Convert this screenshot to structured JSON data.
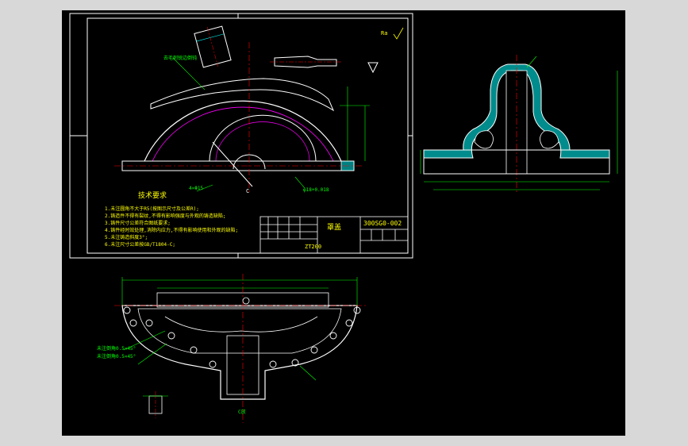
{
  "drawing": {
    "part_name": "罩盖",
    "drawing_number": "300SG0-002",
    "material": "ZT200",
    "surface_mark": "Ra",
    "section_label": "C",
    "detail_label": "C放"
  },
  "technical_requirements": {
    "heading": "技术要求",
    "items": [
      "1.未注圆角不大于R5(按图示尺寸及公差R);",
      "2.铸造件不得有裂纹,不得有影响强度与外观的铸造缺陷;",
      "3.铸件尺寸公差符合图纸要求;",
      "4.铸件经时效处理,消除内应力,不得有影响使用和外观的缺陷;",
      "5.未注铸造斜度3°;",
      "6.未注尺寸公差按GB/T1804-C;"
    ]
  },
  "annotations": {
    "callout_top": "去毛刺锐边倒钝",
    "callout_left": "未注倒角0.5×45°",
    "callout_bottom_left": "未注倒角0.5×45°",
    "callout_notch": "4×Φ15",
    "callout_side": "φ18+0.018"
  },
  "colors": {
    "background": "#000000",
    "frame": "#ffffff",
    "outline": "#ffffff",
    "dimension": "#00ff00",
    "centerline": "#ff0000",
    "hatch": "#00ffff",
    "hidden": "#ff00ff"
  }
}
